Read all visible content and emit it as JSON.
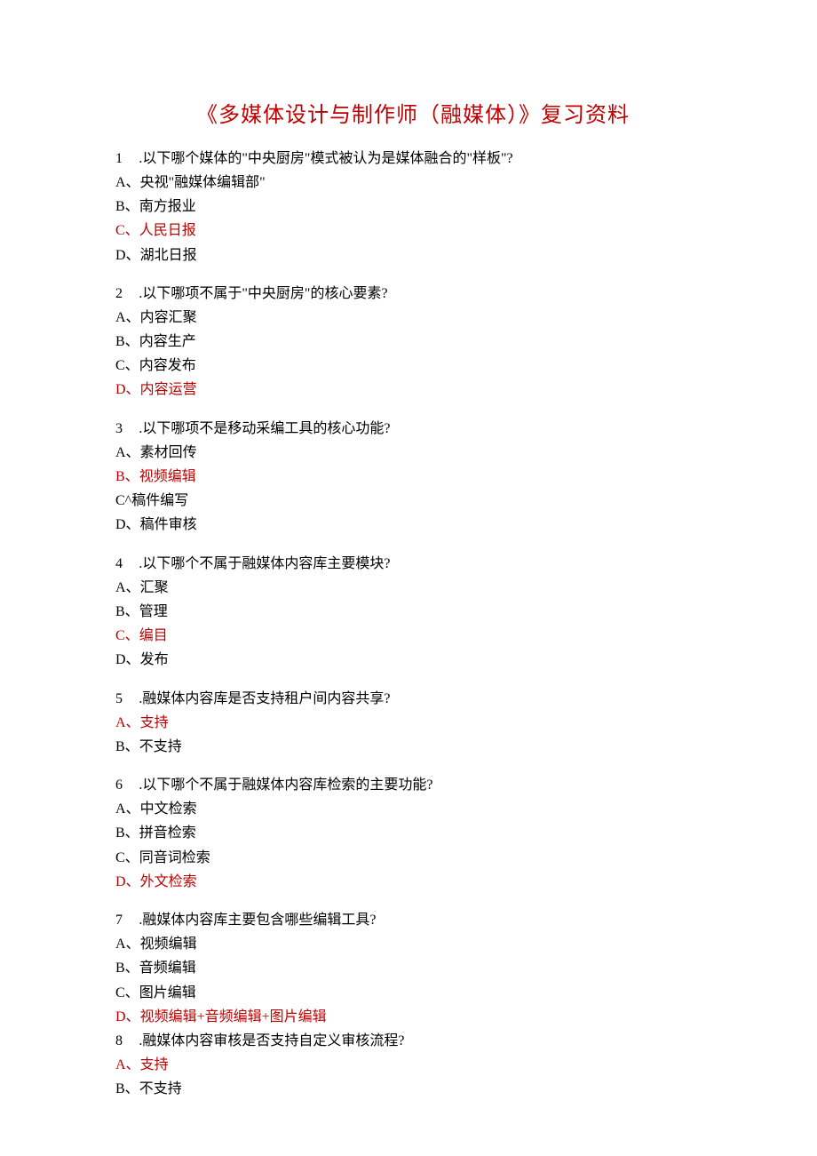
{
  "title": "《多媒体设计与制作师（融媒体）》复习资料",
  "questions": [
    {
      "num": "1",
      "sep": " .",
      "text": "以下哪个媒体的\"中央厨房\"模式被认为是媒体融合的\"样板\"?",
      "options": [
        {
          "label": "A、",
          "text": "央视\"融媒体编辑部\"",
          "red": false
        },
        {
          "label": "B、",
          "text": "南方报业",
          "red": false
        },
        {
          "label": "C、",
          "text": "人民日报",
          "red": true
        },
        {
          "label": "D、",
          "text": "湖北日报",
          "red": false
        }
      ],
      "gap": true
    },
    {
      "num": "2",
      "sep": " .",
      "text": "以下哪项不属于\"中央厨房\"的核心要素?",
      "options": [
        {
          "label": "A、",
          "text": "内容汇聚",
          "red": false
        },
        {
          "label": "B、",
          "text": "内容生产",
          "red": false
        },
        {
          "label": "C、",
          "text": "内容发布",
          "red": false
        },
        {
          "label": "D、",
          "text": "内容运营",
          "red": true
        }
      ],
      "gap": true
    },
    {
      "num": "3",
      "sep": " .",
      "text": "以下哪项不是移动采编工具的核心功能?",
      "options": [
        {
          "label": "A、",
          "text": "素材回传",
          "red": false
        },
        {
          "label": "B、",
          "text": "视频编辑",
          "red": true
        },
        {
          "label": "C^",
          "text": "稿件编写",
          "red": false
        },
        {
          "label": "D、",
          "text": "稿件审核",
          "red": false
        }
      ],
      "gap": true
    },
    {
      "num": "4",
      "sep": " .",
      "text": "以下哪个不属于融媒体内容库主要模块?",
      "options": [
        {
          "label": "A、",
          "text": "汇聚",
          "red": false
        },
        {
          "label": "B、",
          "text": "管理",
          "red": false
        },
        {
          "label": "C、",
          "text": "编目",
          "red": true
        },
        {
          "label": "D、",
          "text": "发布",
          "red": false
        }
      ],
      "gap": true
    },
    {
      "num": "5",
      "sep": " .",
      "text": "融媒体内容库是否支持租户间内容共享?",
      "options": [
        {
          "label": "A、",
          "text": "支持",
          "red": true
        },
        {
          "label": "B、",
          "text": "不支持",
          "red": false
        }
      ],
      "gap": true
    },
    {
      "num": "6",
      "sep": " .",
      "text": "以下哪个不属于融媒体内容库检索的主要功能?",
      "options": [
        {
          "label": "A、",
          "text": "中文检索",
          "red": false
        },
        {
          "label": "B、",
          "text": "拼音检索",
          "red": false
        },
        {
          "label": "C、",
          "text": "同音词检索",
          "red": false
        },
        {
          "label": "D、",
          "text": "外文检索",
          "red": true
        }
      ],
      "gap": true
    },
    {
      "num": "7",
      "sep": " .",
      "text": "融媒体内容库主要包含哪些编辑工具?",
      "options": [
        {
          "label": "A、",
          "text": "视频编辑",
          "red": false
        },
        {
          "label": "B、",
          "text": "音频编辑",
          "red": false
        },
        {
          "label": "C、",
          "text": "图片编辑",
          "red": false
        },
        {
          "label": "D、",
          "text": "视频编辑+音频编辑+图片编辑",
          "red": true
        }
      ],
      "gap": false
    },
    {
      "num": "8",
      "sep": " .",
      "text": "融媒体内容审核是否支持自定义审核流程?",
      "options": [
        {
          "label": "A、",
          "text": "支持",
          "red": true
        },
        {
          "label": "B、",
          "text": "不支持",
          "red": false
        }
      ],
      "gap": false
    }
  ]
}
